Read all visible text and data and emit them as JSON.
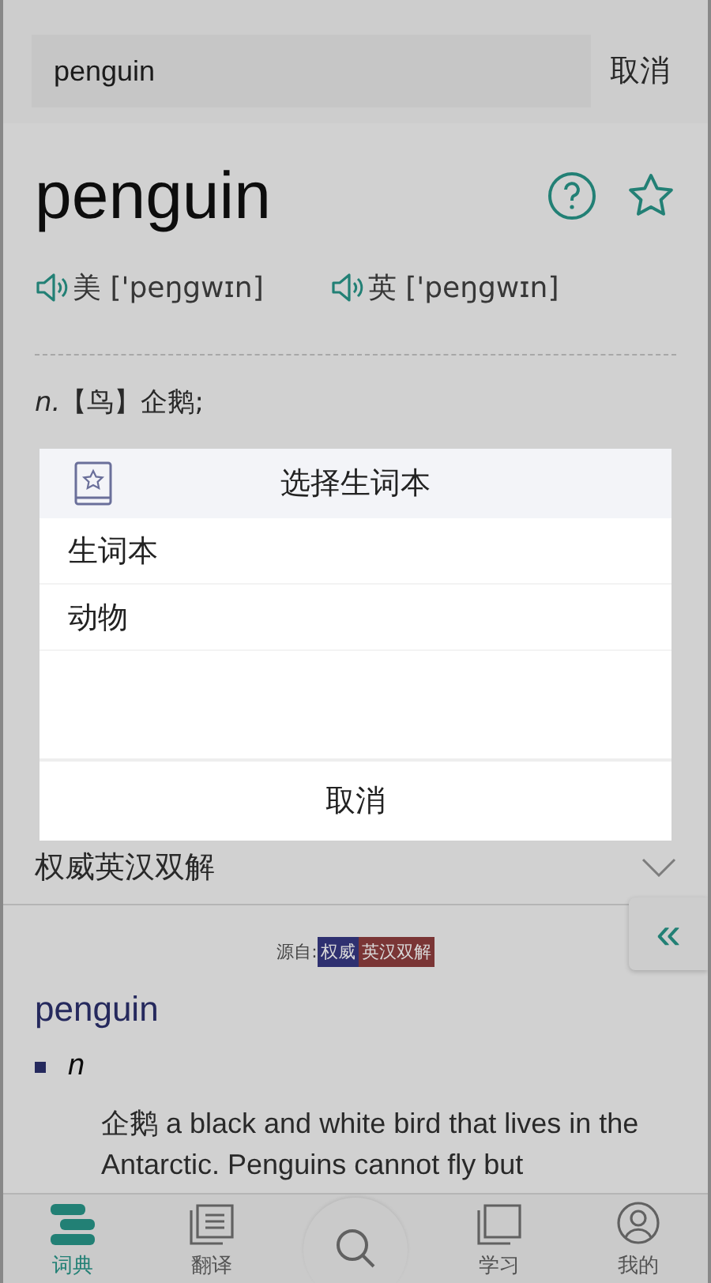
{
  "search": {
    "value": "penguin",
    "cancel": "取消"
  },
  "entry": {
    "word": "penguin",
    "pronunciations": [
      {
        "region": "美",
        "ipa": "['peŋgwɪn]"
      },
      {
        "region": "英",
        "ipa": "['peŋgwɪn]"
      }
    ],
    "definition": "*n.*【鸟】企鹅;"
  },
  "section": {
    "title": "权威英汉双解",
    "source_label": "源自:",
    "source_tags": [
      {
        "text": "权威",
        "color": "#2e3070"
      },
      {
        "text": "英汉双解",
        "color": "#7a3535"
      }
    ],
    "headword": "penguin",
    "pos": "n",
    "sense": "企鹅 a black and white bird that lives in the Antarctic. Penguins cannot fly but"
  },
  "side_tab": {
    "text": "«"
  },
  "dialog": {
    "title": "选择生词本",
    "items": [
      {
        "label": "生词本"
      },
      {
        "label": "动物"
      }
    ],
    "cancel": "取消"
  },
  "nav": [
    {
      "label": "词典",
      "selected": true
    },
    {
      "label": "翻译",
      "selected": false
    },
    {
      "selected": false
    },
    {
      "label": "学习",
      "selected": false
    },
    {
      "label": "我的",
      "selected": false
    }
  ]
}
